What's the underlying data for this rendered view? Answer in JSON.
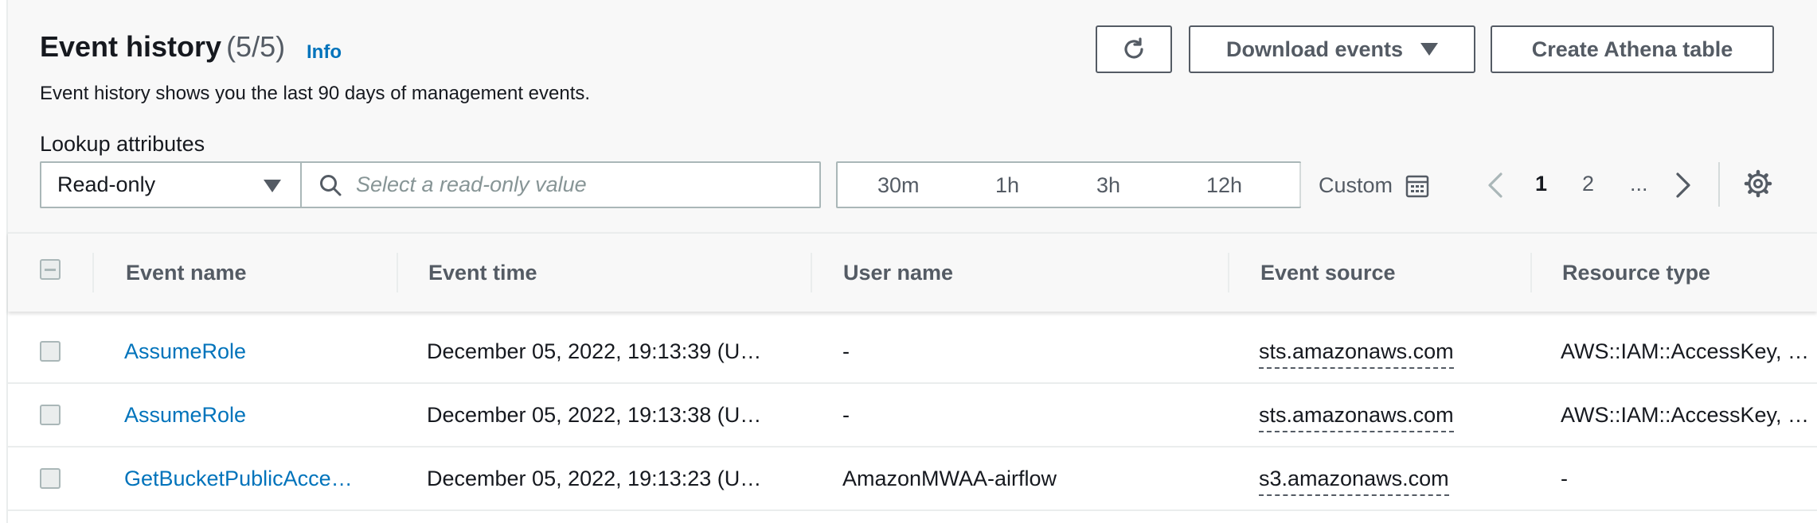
{
  "header": {
    "title": "Event history",
    "count": "(5/5)",
    "info_link": "Info",
    "description": "Event history shows you the last 90 days of management events."
  },
  "toolbar": {
    "refresh_icon": "refresh-icon",
    "download_label": "Download events",
    "athena_label": "Create Athena table"
  },
  "lookup": {
    "label": "Lookup attributes",
    "attribute": "Read-only",
    "placeholder": "Select a read-only value"
  },
  "time_range": {
    "options": [
      "30m",
      "1h",
      "3h",
      "12h"
    ],
    "custom_label": "Custom"
  },
  "pagination": {
    "current": "1",
    "next_page": "2",
    "ellipsis": "..."
  },
  "table": {
    "columns": [
      "Event name",
      "Event time",
      "User name",
      "Event source",
      "Resource type"
    ],
    "rows": [
      {
        "event_name": "AssumeRole",
        "event_time": "December 05, 2022, 19:13:39 (U…",
        "user_name": "-",
        "event_source": "sts.amazonaws.com",
        "resource_type": "AWS::IAM::AccessKey, …"
      },
      {
        "event_name": "AssumeRole",
        "event_time": "December 05, 2022, 19:13:38 (U…",
        "user_name": "-",
        "event_source": "sts.amazonaws.com",
        "resource_type": "AWS::IAM::AccessKey, …"
      },
      {
        "event_name": "GetBucketPublicAcce…",
        "event_time": "December 05, 2022, 19:13:23 (U…",
        "user_name": "AmazonMWAA-airflow",
        "event_source": "s3.amazonaws.com",
        "resource_type": "-"
      }
    ]
  },
  "colors": {
    "link": "#0073bb",
    "text": "#16191f",
    "muted": "#545b64",
    "header_bg": "#f8f8f8",
    "border": "#aab7b8"
  }
}
